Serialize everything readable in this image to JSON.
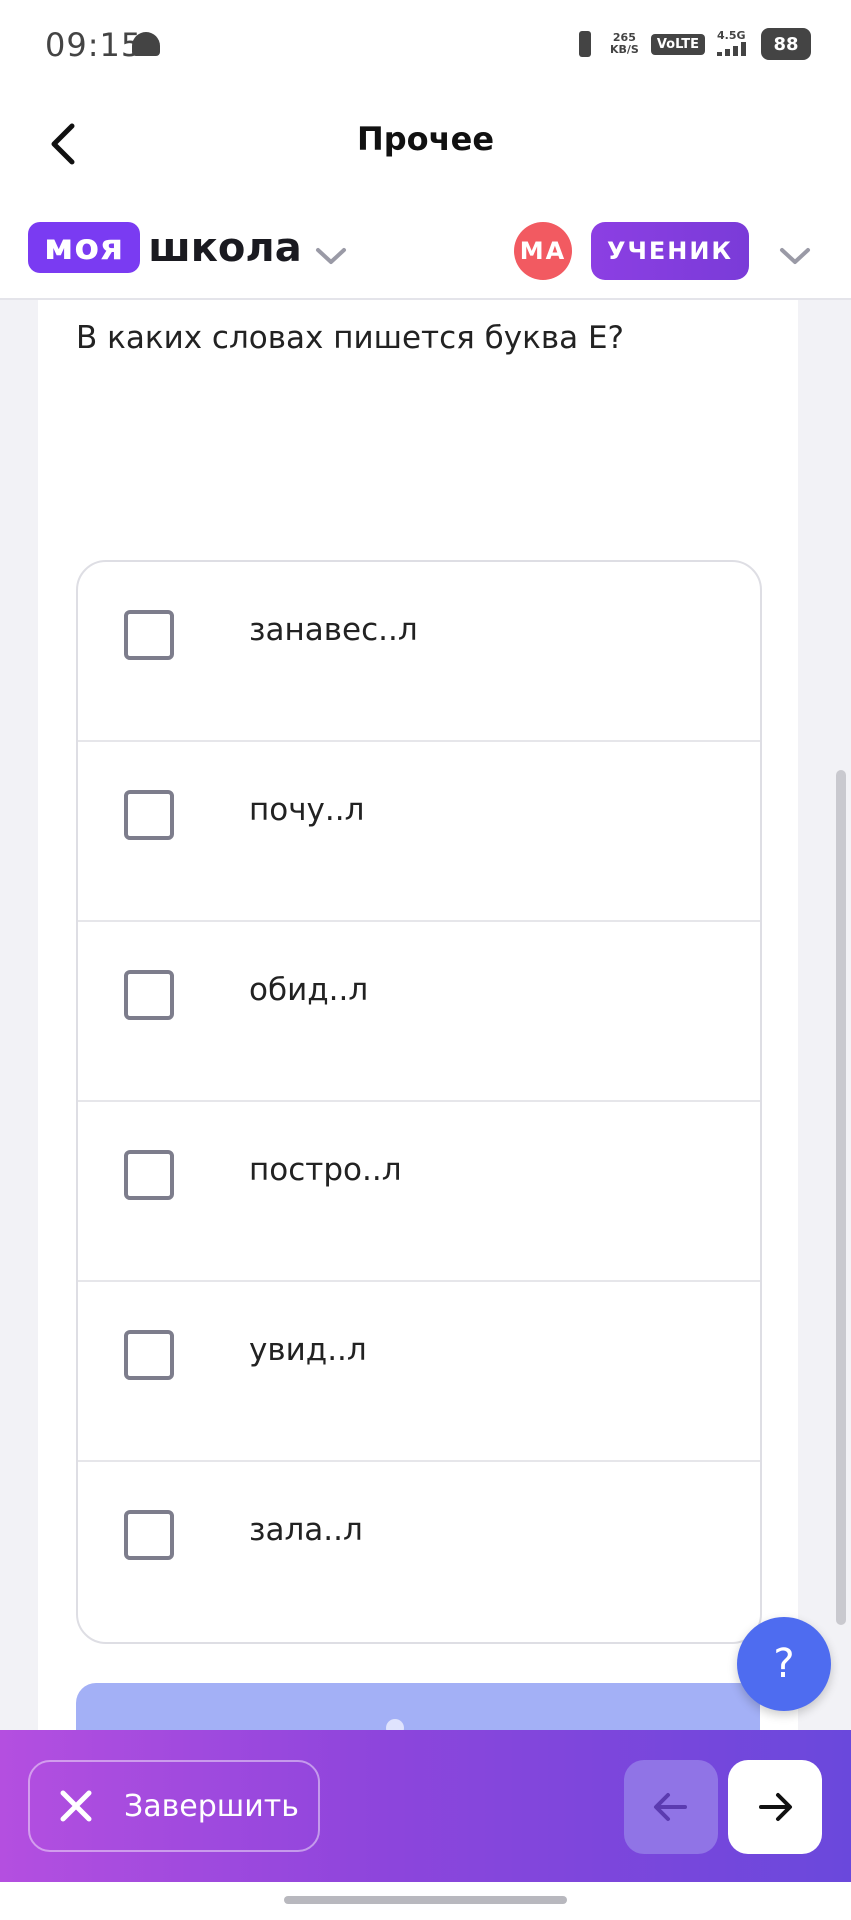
{
  "status_bar": {
    "time": "09:15",
    "speed_value": "265",
    "speed_unit": "KB/S",
    "volte": "VoLTE",
    "network": "4.5G",
    "battery": "88",
    "icons": [
      "android-icon",
      "vibrate-icon",
      "signal-icon",
      "battery-icon"
    ]
  },
  "header": {
    "title": "Прочее",
    "back_icon": "chevron-left-icon"
  },
  "brand": {
    "part1": "моя",
    "part2": "школа",
    "accent_color": "#7a3bf2"
  },
  "user": {
    "initials": "МА",
    "role": "УЧЕНИК",
    "avatar_color": "#f25a61"
  },
  "question": {
    "text": "В каких словах пишется буква Е?",
    "options": [
      {
        "label": "занавес..л",
        "checked": false
      },
      {
        "label": "почу..л",
        "checked": false
      },
      {
        "label": "обид..л",
        "checked": false
      },
      {
        "label": "постро..л",
        "checked": false
      },
      {
        "label": "увид..л",
        "checked": false
      },
      {
        "label": "зала..л",
        "checked": false
      }
    ]
  },
  "help": {
    "label": "?",
    "color": "#4e6cf0"
  },
  "bottom_bar": {
    "finish_label": "Завершить",
    "finish_icon": "close-icon",
    "prev_icon": "arrow-left-icon",
    "next_icon": "arrow-right-icon"
  }
}
